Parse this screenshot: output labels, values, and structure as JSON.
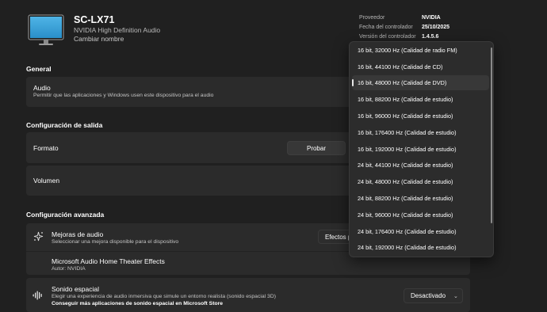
{
  "device": {
    "name": "SC-LX71",
    "description": "NVIDIA High Definition Audio",
    "rename_label": "Cambiar nombre"
  },
  "driver": {
    "provider_label": "Proveedor",
    "provider_value": "NVIDIA",
    "date_label": "Fecha del controlador",
    "date_value": "25/10/2025",
    "version_label": "Versión del controlador",
    "version_value": "1.4.5.6"
  },
  "general": {
    "section_title": "General",
    "audio_title": "Audio",
    "audio_desc": "Permitir que las aplicaciones y Windows usen este dispositivo para el audio"
  },
  "output": {
    "section_title": "Configuración de salida",
    "format_label": "Formato",
    "test_button": "Probar",
    "volume_label": "Volumen"
  },
  "advanced": {
    "section_title": "Configuración avanzada",
    "enhancements_title": "Mejoras de audio",
    "enhancements_desc": "Seleccionar una mejora disponible para el dispositivo",
    "enhancements_value": "Efectos p",
    "effects_title": "Microsoft Audio Home Theater Effects",
    "effects_author": "Autor: NVIDIA",
    "spatial_title": "Sonido espacial",
    "spatial_desc": "Elegir una experiencia de audio inmersiva que simule un entorno realista (sonido espacial 3D)",
    "spatial_link": "Conseguir más aplicaciones de sonido espacial en Microsoft Store",
    "spatial_value": "Desactivado"
  },
  "format_dropdown": {
    "selected_index": 2,
    "options": [
      "16 bit, 32000 Hz (Calidad de radio FM)",
      "16 bit, 44100 Hz (Calidad de CD)",
      "16 bit, 48000 Hz (Calidad de DVD)",
      "16 bit, 88200 Hz (Calidad de estudio)",
      "16 bit, 96000 Hz (Calidad de estudio)",
      "16 bit, 176400 Hz (Calidad de estudio)",
      "16 bit, 192000 Hz (Calidad de estudio)",
      "24 bit, 44100 Hz (Calidad de estudio)",
      "24 bit, 48000 Hz (Calidad de estudio)",
      "24 bit, 88200 Hz (Calidad de estudio)",
      "24 bit, 96000 Hz (Calidad de estudio)",
      "24 bit, 176400 Hz (Calidad de estudio)",
      "24 bit, 192000 Hz (Calidad de estudio)"
    ]
  },
  "icons": {
    "monitor": "monitor-icon",
    "enhancements": "sparkle-icon",
    "spatial": "sound-wave-icon",
    "chevron": "chevron-down-icon"
  },
  "colors": {
    "background": "#202020",
    "card": "#2b2b2b",
    "monitor_screen": "#3ba3d8"
  }
}
